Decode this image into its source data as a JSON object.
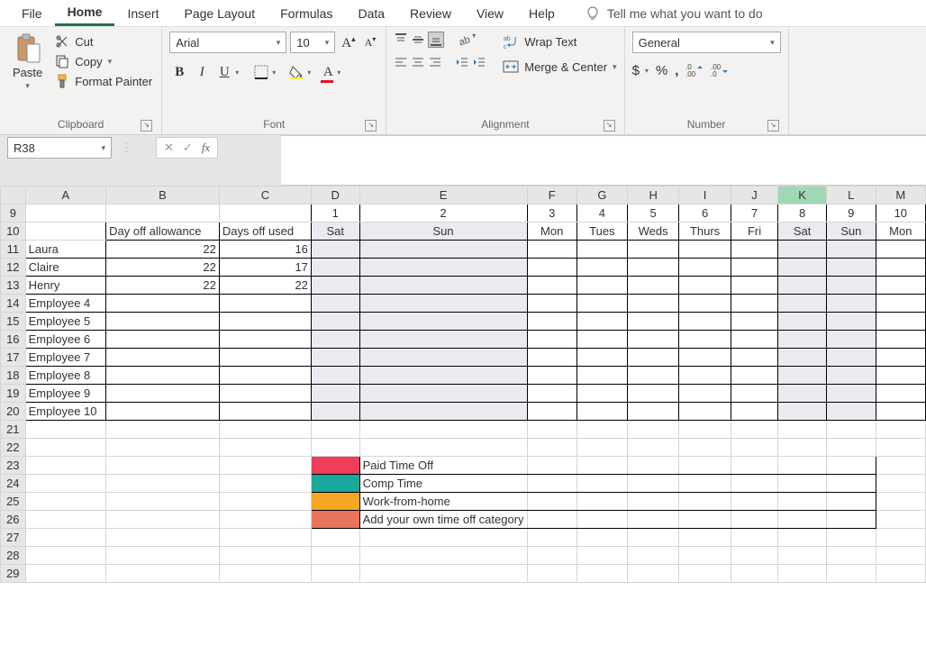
{
  "menu": {
    "file": "File",
    "home": "Home",
    "insert": "Insert",
    "pageLayout": "Page Layout",
    "formulas": "Formulas",
    "data": "Data",
    "review": "Review",
    "view": "View",
    "help": "Help",
    "tell": "Tell me what you want to do"
  },
  "ribbon": {
    "clipboard": {
      "label": "Clipboard",
      "paste": "Paste",
      "cut": "Cut",
      "copy": "Copy",
      "formatPainter": "Format Painter"
    },
    "font": {
      "label": "Font",
      "name": "Arial",
      "size": "10"
    },
    "alignment": {
      "label": "Alignment",
      "wrap": "Wrap Text",
      "merge": "Merge & Center"
    },
    "number": {
      "label": "Number",
      "format": "General"
    }
  },
  "nameBox": "R38",
  "columns": [
    "A",
    "B",
    "C",
    "D",
    "E",
    "F",
    "G",
    "H",
    "I",
    "J",
    "K",
    "L",
    "M"
  ],
  "highlightCol": "K",
  "rows": [
    9,
    10,
    11,
    12,
    13,
    14,
    15,
    16,
    17,
    18,
    19,
    20,
    21,
    22,
    23,
    24,
    25,
    26,
    27,
    28,
    29
  ],
  "headerRow": {
    "numbers": [
      "1",
      "2",
      "3",
      "4",
      "5",
      "6",
      "7",
      "8",
      "9",
      "10"
    ],
    "b": "Day off allowance",
    "c": "Days off used",
    "days": [
      "Sat",
      "Sun",
      "Mon",
      "Tues",
      "Weds",
      "Thurs",
      "Fri",
      "Sat",
      "Sun",
      "Mon"
    ]
  },
  "employees": [
    {
      "name": "Laura",
      "allow": "22",
      "used": "16"
    },
    {
      "name": "Claire",
      "allow": "22",
      "used": "17"
    },
    {
      "name": "Henry",
      "allow": "22",
      "used": "22"
    },
    {
      "name": "Employee 4",
      "allow": "",
      "used": ""
    },
    {
      "name": "Employee 5",
      "allow": "",
      "used": ""
    },
    {
      "name": "Employee 6",
      "allow": "",
      "used": ""
    },
    {
      "name": "Employee 7",
      "allow": "",
      "used": ""
    },
    {
      "name": "Employee 8",
      "allow": "",
      "used": ""
    },
    {
      "name": "Employee 9",
      "allow": "",
      "used": ""
    },
    {
      "name": "Employee 10",
      "allow": "",
      "used": ""
    }
  ],
  "legend": [
    {
      "color": "pink",
      "label": "Paid Time Off"
    },
    {
      "color": "teal",
      "label": "Comp Time"
    },
    {
      "color": "orange",
      "label": "Work-from-home"
    },
    {
      "color": "salmon",
      "label": "Add your own time off category"
    }
  ],
  "weekendCols": [
    "D",
    "E",
    "K",
    "L"
  ]
}
